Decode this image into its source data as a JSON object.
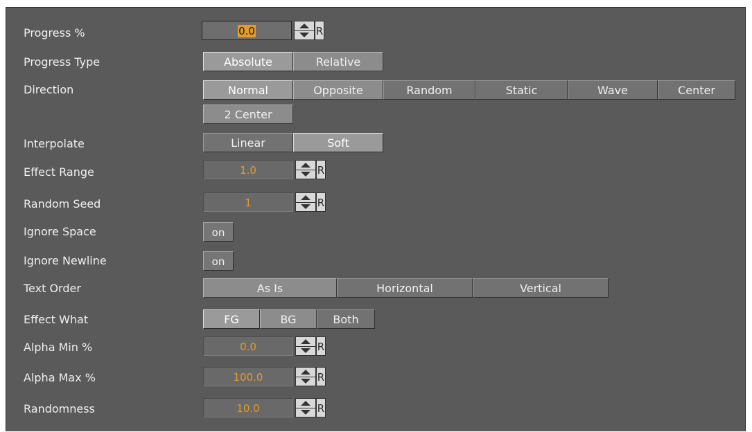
{
  "rows": {
    "progress": {
      "label": "Progress %",
      "value": "0.0",
      "reset": "R"
    },
    "progress_type": {
      "label": "Progress Type",
      "options": [
        "Absolute",
        "Relative"
      ],
      "selected": "Absolute"
    },
    "direction": {
      "label": "Direction",
      "options": [
        "Normal",
        "Opposite",
        "Random",
        "Static",
        "Wave",
        "Center",
        "2 Center"
      ],
      "selected": "Normal"
    },
    "interpolate": {
      "label": "Interpolate",
      "options": [
        "Linear",
        "Soft"
      ],
      "selected": "Linear"
    },
    "effect_range": {
      "label": "Effect Range",
      "value": "1.0",
      "reset": "R"
    },
    "random_seed": {
      "label": "Random Seed",
      "value": "1",
      "reset": "R"
    },
    "ignore_space": {
      "label": "Ignore Space",
      "toggle": "on"
    },
    "ignore_newline": {
      "label": "Ignore Newline",
      "toggle": "on"
    },
    "text_order": {
      "label": "Text Order",
      "options": [
        "As Is",
        "Horizontal",
        "Vertical"
      ],
      "selected": "As Is"
    },
    "effect_what": {
      "label": "Effect What",
      "options": [
        "FG",
        "BG",
        "Both"
      ],
      "selected": "FG"
    },
    "alpha_min": {
      "label": "Alpha Min %",
      "value": "0.0",
      "reset": "R"
    },
    "alpha_max": {
      "label": "Alpha Max %",
      "value": "100.0",
      "reset": "R"
    },
    "randomness": {
      "label": "Randomness",
      "value": "10.0",
      "reset": "R"
    }
  },
  "icons": {
    "spin": "spinner-arrows-icon"
  },
  "colors": {
    "panel_bg": "#5a5a5a",
    "value_text": "#e39b2e",
    "label_text": "#f0f0f0"
  }
}
